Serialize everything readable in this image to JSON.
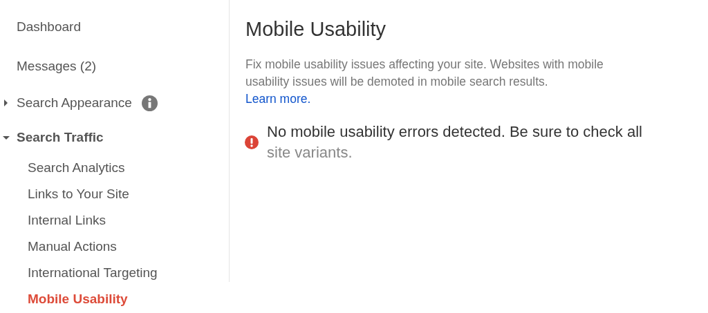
{
  "sidebar": {
    "items": [
      {
        "label": "Dashboard",
        "kind": "item",
        "selected": false
      },
      {
        "label": "Messages (2)",
        "kind": "item",
        "selected": false
      },
      {
        "label": "Search Appearance",
        "kind": "group",
        "expanded": false,
        "info_icon": true,
        "selected": false
      },
      {
        "label": "Search Traffic",
        "kind": "group",
        "expanded": true,
        "info_icon": false,
        "selected": false,
        "children": [
          {
            "label": "Search Analytics",
            "selected": false
          },
          {
            "label": "Links to Your Site",
            "selected": false
          },
          {
            "label": "Internal Links",
            "selected": false
          },
          {
            "label": "Manual Actions",
            "selected": false
          },
          {
            "label": "International Targeting",
            "selected": false
          },
          {
            "label": "Mobile Usability",
            "selected": true
          }
        ]
      }
    ]
  },
  "main": {
    "title": "Mobile Usability",
    "description": "Fix mobile usability issues affecting your site. Websites with mobile usability issues will be demoted in mobile search results.",
    "learn_more": "Learn more.",
    "alert": {
      "text": "No mobile usability errors detected. Be sure to check all ",
      "link": "site variants."
    }
  }
}
